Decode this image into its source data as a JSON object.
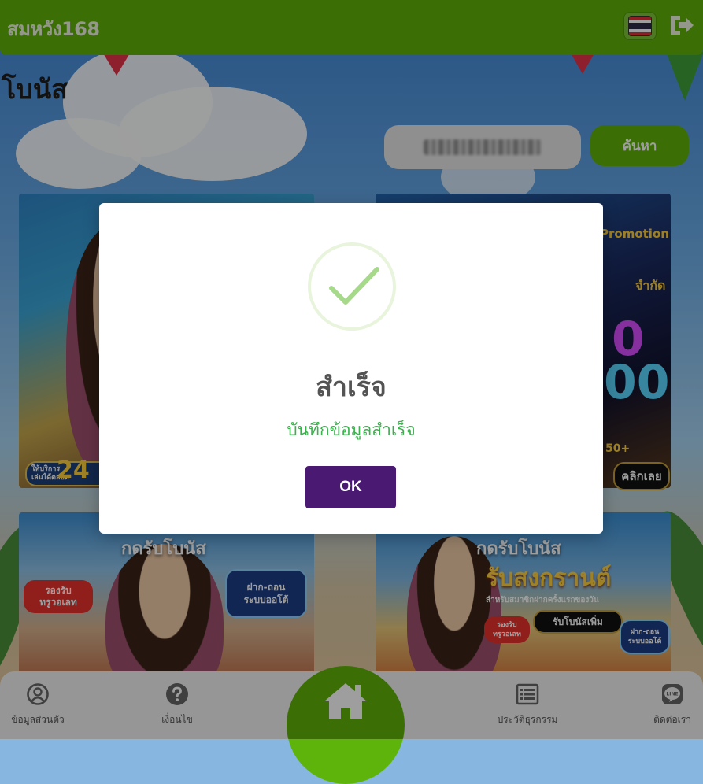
{
  "colors": {
    "brand_green": "#5fb40b",
    "modal_button": "#4a1a73",
    "success_text": "#3bb04d",
    "success_check": "#a6d98a"
  },
  "header": {
    "brand": "สมหวัง168",
    "language_icon": "thai-flag-icon",
    "logout_icon": "logout-icon"
  },
  "page": {
    "title": "โบนัส"
  },
  "search": {
    "button_label": "ค้นหา"
  },
  "promos": [
    {
      "badge_line1": "ให้บริการ",
      "badge_line2": "เล่นได้ตลอด",
      "big_text": "24"
    },
    {
      "promo_word": "Promotion",
      "label_limit": "จำกัด",
      "click_label": "คลิกเลย",
      "bonus": "50+"
    },
    {
      "label": "กดรับโบนัส",
      "tag1": "รองรับ",
      "tag2": "ทรูวอเลท",
      "tag3": "ฝาก-ถอน",
      "tag4": "ระบบออโต้"
    },
    {
      "label": "กดรับโบนัส",
      "headline": "รับสงกรานต์",
      "sub": "สำหรับสมาชิกฝากครั้งแรกของวัน",
      "pill": "รับโบนัสเพิ่ม",
      "tag1": "รองรับ",
      "tag2": "ทรูวอเลท",
      "tag3": "ฝาก-ถอน",
      "tag4": "ระบบออโต้"
    }
  ],
  "bottom_nav": {
    "items": [
      {
        "label": "ข้อมูลส่วนตัว",
        "icon": "user-circle-icon"
      },
      {
        "label": "เงื่อนไข",
        "icon": "question-circle-icon"
      },
      {
        "label": "",
        "icon": "home-icon"
      },
      {
        "label": "ประวัติธุรกรรม",
        "icon": "list-icon"
      },
      {
        "label": "ติดต่อเรา",
        "icon": "line-chat-icon"
      }
    ]
  },
  "modal": {
    "icon": "check-icon",
    "title": "สำเร็จ",
    "message": "บันทึกข้อมูลสำเร็จ",
    "ok_label": "OK"
  }
}
